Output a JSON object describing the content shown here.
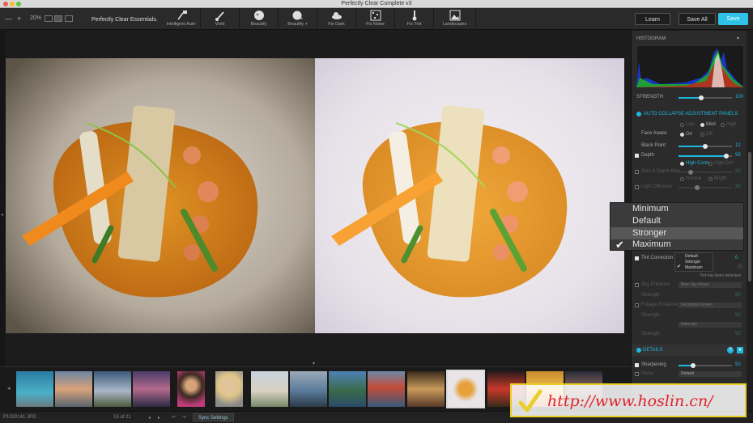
{
  "window": {
    "title": "Perfectly Clear Complete v3"
  },
  "toolbar": {
    "zoom_minus": "—",
    "zoom_plus": "+",
    "zoom_level": "20%",
    "preset": "Perfectly Clear Essentials",
    "tools": [
      {
        "label": "Intelligent Auto",
        "icon": "wand-hd-icon"
      },
      {
        "label": "Vivid",
        "icon": "brush-icon"
      },
      {
        "label": "Beautify",
        "icon": "face-icon"
      },
      {
        "label": "Beautify +",
        "icon": "face-plus-icon"
      },
      {
        "label": "Fix Dark",
        "icon": "cloud-icon"
      },
      {
        "label": "Fix Noise",
        "icon": "noise-icon"
      },
      {
        "label": "Fix Tint",
        "icon": "thermometer-icon"
      },
      {
        "label": "Landscapes",
        "icon": "landscape-icon"
      }
    ],
    "learn": "Learn",
    "save_all": "Save All",
    "save": "Save"
  },
  "panel": {
    "histogram": "HISTOGRAM",
    "strength": {
      "label": "STRENGTH",
      "value": "100"
    },
    "auto_collapse": "AUTO COLLAPSE ADJUSTMENT PANELS",
    "level_options": [
      "Low",
      "Med",
      "High"
    ],
    "face_aware": {
      "label": "Face Aware",
      "options": [
        "On",
        "Off"
      ]
    },
    "black_point": {
      "label": "Black Point",
      "value": "12"
    },
    "depth": {
      "label": "Depth",
      "value": "93",
      "options": [
        "High Contr",
        "High Def"
      ]
    },
    "skin_depth_bias": {
      "label": "Skin & Depth Bias",
      "value": "20",
      "options": [
        "Normal",
        "Bright"
      ]
    },
    "light_diffusion": {
      "label": "Light Diffusion",
      "value": "30"
    },
    "tint_correction": {
      "label": "Tint Correction",
      "value": "0"
    },
    "tint_note": "Tint has been detected",
    "sky_enhance": {
      "label": "Sky Enhance",
      "dropdown": "Blue Sky Royal"
    },
    "sky_strength": {
      "label": "Strength",
      "value": "50"
    },
    "foliage_enhance": {
      "label": "Foliage Enhance",
      "dropdown": "Deciduous Green"
    },
    "foliage_strength": {
      "label": "Strength",
      "value": "50"
    },
    "foliage_mode": "Naturally",
    "foliage_strength2": {
      "label": "Strength",
      "value": "50"
    },
    "details": "DETAILS",
    "sharpening": {
      "label": "Sharpening",
      "value": "50"
    },
    "noise": {
      "label": "Noise",
      "dropdown": "Default"
    }
  },
  "popup": {
    "items": [
      "Minimum",
      "Default",
      "Stronger",
      "Maximum"
    ],
    "highlighted": "Stronger",
    "checked": "Maximum"
  },
  "mini_menu": {
    "items": [
      "Default",
      "Stronger",
      "Maximum"
    ]
  },
  "status": {
    "filename": "P1020141.JPG",
    "counter": "15 of 21",
    "sync": "Sync Settings"
  },
  "watermark": "http://www.hoslin.cn/",
  "colors": {
    "accent": "#1fb6e0",
    "save_button": "#2fc2e8",
    "watermark_border": "#e8cf27",
    "watermark_text": "#e0232b"
  }
}
